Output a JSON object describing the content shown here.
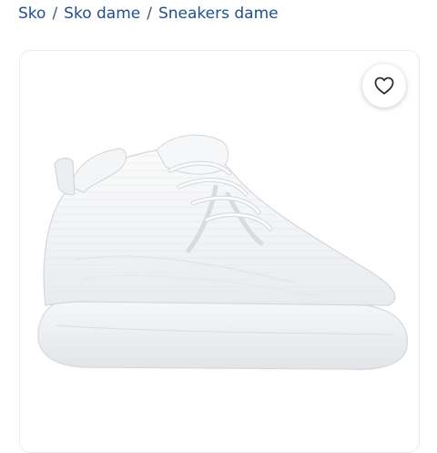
{
  "breadcrumb": {
    "items": [
      "Sko",
      "Sko dame",
      "Sneakers dame"
    ],
    "separator": "/"
  },
  "product": {
    "image_icon": "white-sneaker-image",
    "favorite_icon": "heart-outline-icon"
  },
  "colors": {
    "link": "#1f4f8f",
    "card_border": "#ececec"
  }
}
